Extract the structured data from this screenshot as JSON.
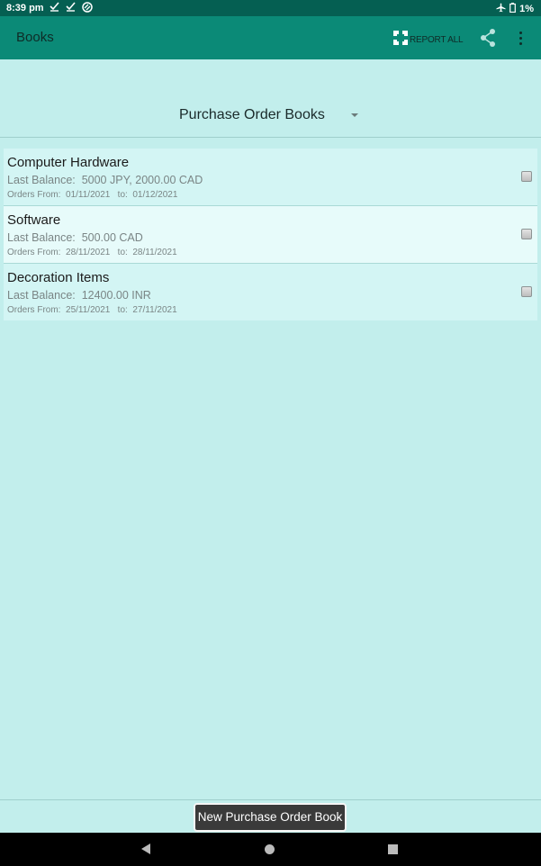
{
  "status_bar": {
    "time": "8:39 pm",
    "notification_icons": [
      "checkmark-icon",
      "checkmark-icon",
      "sync-icon"
    ],
    "battery": "1%",
    "airplane_mode": true
  },
  "app_bar": {
    "title": "Books",
    "report_all_label": "REPORT ALL",
    "icons": {
      "report": "report-all-icon",
      "share": "share-icon",
      "more": "more-vert-icon"
    }
  },
  "spinner": {
    "selected": "Purchase Order Books"
  },
  "books": [
    {
      "name": "Computer Hardware",
      "balance_label": "Last Balance:",
      "balance": "5000 JPY, 2000.00 CAD",
      "from_label": "Orders From:",
      "from": "01/11/2021",
      "to_label": "to:",
      "to": "01/12/2021",
      "checked": false
    },
    {
      "name": "Software",
      "balance_label": "Last Balance:",
      "balance": "500.00 CAD",
      "from_label": "Orders From:",
      "from": "28/11/2021",
      "to_label": "to:",
      "to": "28/11/2021",
      "checked": false
    },
    {
      "name": "Decoration Items",
      "balance_label": "Last Balance:",
      "balance": "12400.00 INR",
      "from_label": "Orders From:",
      "from": "25/11/2021",
      "to_label": "to:",
      "to": "27/11/2021",
      "checked": false
    }
  ],
  "footer": {
    "new_button_label": "New Purchase Order Book"
  },
  "colors": {
    "status_bar": "#055f52",
    "app_bar": "#0b8a77",
    "background": "#c2eeec"
  }
}
